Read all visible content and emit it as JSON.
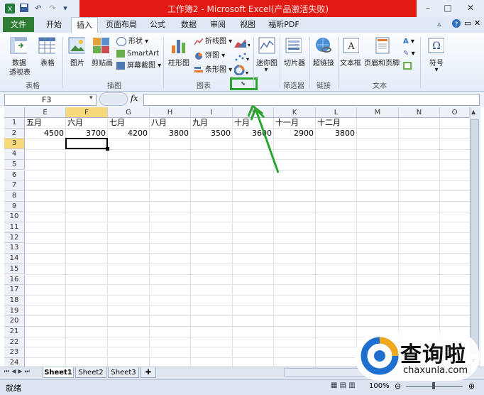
{
  "window": {
    "title": "工作簿2 - Microsoft Excel(产品激活失败)",
    "min": "–",
    "max": "□",
    "close": "✕"
  },
  "tabs": [
    {
      "label": "文件"
    },
    {
      "label": "开始"
    },
    {
      "label": "插入"
    },
    {
      "label": "页面布局"
    },
    {
      "label": "公式"
    },
    {
      "label": "数据"
    },
    {
      "label": "审阅"
    },
    {
      "label": "视图"
    },
    {
      "label": "福昕PDF"
    }
  ],
  "ribbon": {
    "groups": {
      "tables": "表格",
      "illustrations": "插图",
      "charts": "图表",
      "sparklines": "",
      "filter": "筛选器",
      "links": "链接",
      "text": "文本",
      "symbols": ""
    },
    "pivot_line1": "数据",
    "pivot_line2": "透视表",
    "table": "表格",
    "picture": "图片",
    "clipart": "剪贴画",
    "shapes": "形状",
    "smartart": "SmartArt",
    "screenshot": "屏幕截图",
    "column_chart": "柱形图",
    "line_chart": "折线图",
    "pie_chart": "饼图",
    "bar_chart": "条形图",
    "sparkline": "迷你图",
    "slicer": "切片器",
    "hyperlink": "超链接",
    "textbox": "文本框",
    "header_footer": "页眉和页脚",
    "symbol": "符号"
  },
  "formula_bar": {
    "namebox": "F3",
    "fx": "fx",
    "value": ""
  },
  "grid": {
    "columns": [
      "E",
      "F",
      "G",
      "H",
      "I",
      "J",
      "K",
      "L",
      "M",
      "N",
      "O"
    ],
    "rows": [
      "1",
      "2",
      "3",
      "4",
      "5",
      "6",
      "7",
      "8",
      "9",
      "10",
      "11",
      "12",
      "13",
      "14",
      "15",
      "16",
      "17",
      "18",
      "19",
      "20",
      "21",
      "22",
      "23",
      "24"
    ],
    "row1": [
      "五月",
      "六月",
      "七月",
      "八月",
      "九月",
      "十月",
      "十一月",
      "十二月"
    ],
    "row2": [
      "4500",
      "3700",
      "4200",
      "3800",
      "3500",
      "3600",
      "2900",
      "3800"
    ],
    "selected_cell": "F3"
  },
  "sheets": [
    "Sheet1",
    "Sheet2",
    "Sheet3"
  ],
  "status": {
    "ready": "就绪",
    "zoom": "100%"
  },
  "watermark": {
    "text": "查询啦",
    "url": "chaxunla.com"
  },
  "colors": {
    "title_red": "#e11a14",
    "file_tab": "#2e7d32",
    "highlight_green": "#2aa52f"
  }
}
